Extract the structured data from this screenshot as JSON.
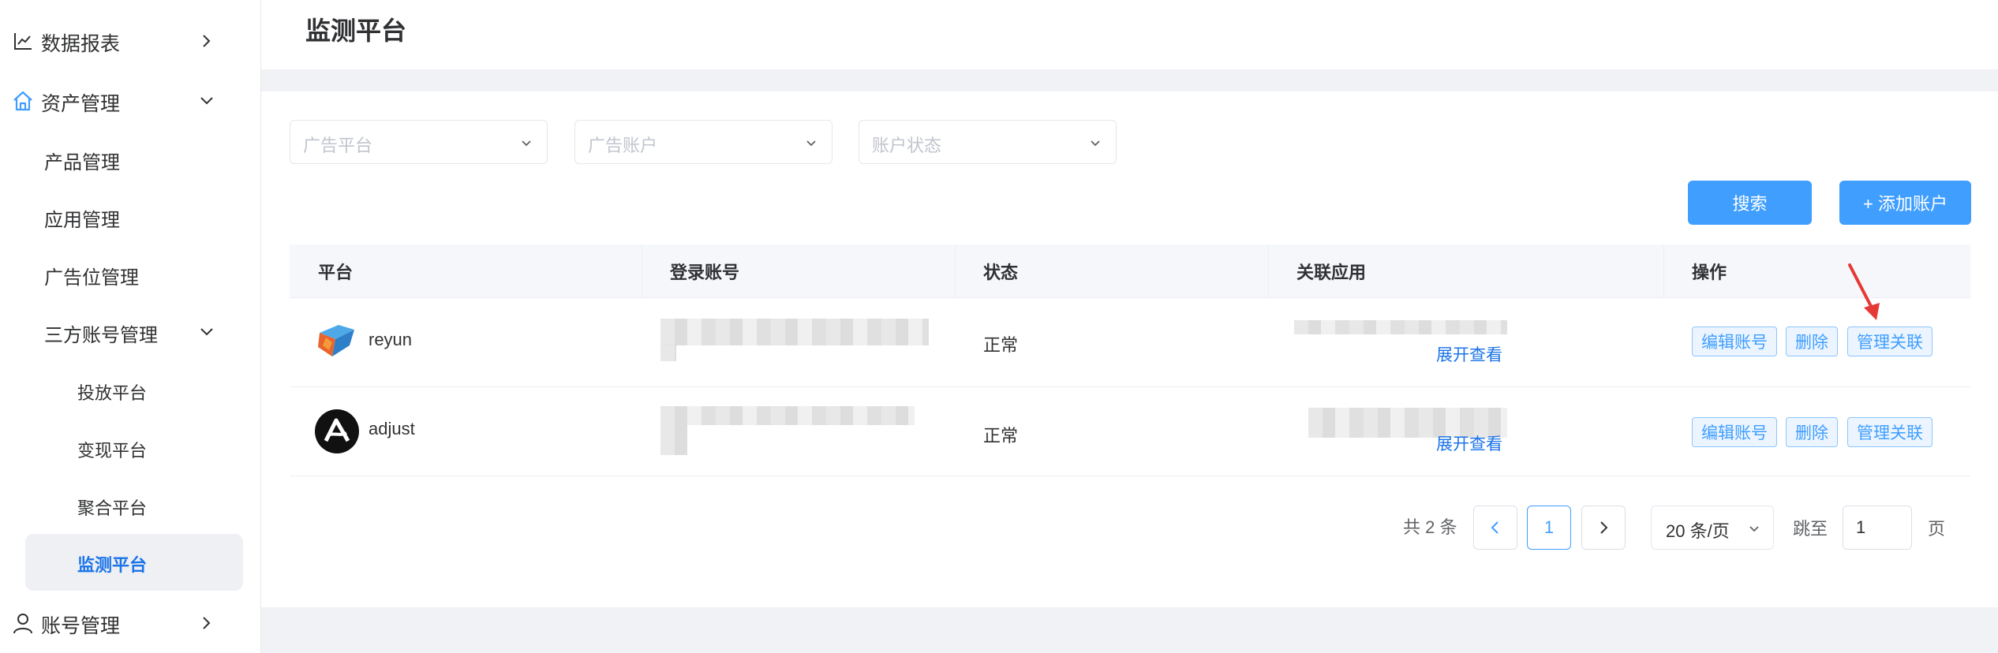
{
  "sidebar": {
    "items": [
      {
        "label": "数据报表",
        "icon": "line-chart-icon"
      },
      {
        "label": "资产管理",
        "icon": "home-icon"
      },
      {
        "label": "账号管理",
        "icon": "user-icon"
      }
    ],
    "asset_children": [
      "产品管理",
      "应用管理",
      "广告位管理",
      "三方账号管理"
    ],
    "third_party_children": [
      "投放平台",
      "变现平台",
      "聚合平台",
      "监测平台"
    ]
  },
  "page": {
    "title": "监测平台"
  },
  "filters": {
    "ad_platform_placeholder": "广告平台",
    "ad_account_placeholder": "广告账户",
    "account_status_placeholder": "账户状态"
  },
  "buttons": {
    "search": "搜索",
    "add_account": "+ 添加账户"
  },
  "table": {
    "columns": [
      "平台",
      "登录账号",
      "状态",
      "关联应用",
      "操作"
    ],
    "rows": [
      {
        "platform": "reyun",
        "status": "正常",
        "expand": "展开查看",
        "actions": [
          "编辑账号",
          "删除",
          "管理关联"
        ]
      },
      {
        "platform": "adjust",
        "status": "正常",
        "expand": "展开查看",
        "actions": [
          "编辑账号",
          "删除",
          "管理关联"
        ]
      }
    ]
  },
  "pagination": {
    "total_text": "共 2 条",
    "current_page": "1",
    "page_size": "20 条/页",
    "jump_label": "跳至",
    "jump_value": "1",
    "page_unit": "页"
  },
  "colors": {
    "accent": "#409eff",
    "active_text": "#1a73e8",
    "annotation_arrow": "#e53935"
  }
}
